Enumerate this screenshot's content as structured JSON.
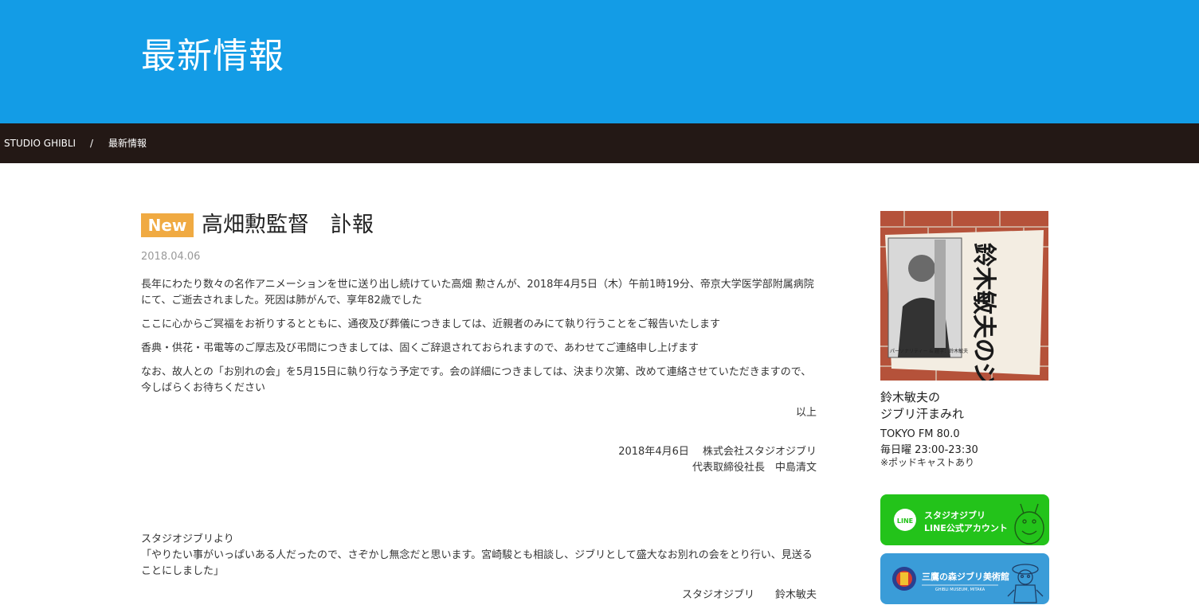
{
  "header": {
    "title": "最新情報"
  },
  "breadcrumb": {
    "home": "STUDIO GHIBLI",
    "separator": "/",
    "current": "最新情報"
  },
  "article": {
    "badge": "New",
    "title": "高畑勲監督　訃報",
    "date": "2018.04.06",
    "paragraphs": [
      "長年にわたり数々の名作アニメーションを世に送り出し続けていた高畑 勲さんが、2018年4月5日（木）午前1時19分、帝京大学医学部附属病院にて、ご逝去されました。死因は肺がんで、享年82歳でした",
      "ここに心からご冥福をお祈りするとともに、通夜及び葬儀につきましては、近親者のみにて執り行うことをご報告いたします",
      "香典・供花・弔電等のご厚志及び弔問につきましては、固くご辞退されておられますので、あわせてご連絡申し上げます",
      "なお、故人との「お別れの会」を5月15日に執り行なう予定です。会の詳細につきましては、決まり次第、改めて連絡させていただきますので、今しばらくお待ちください"
    ],
    "closing": "以上",
    "sign_line1": "2018年4月6日　 株式会社スタジオジブリ",
    "sign_line2": "代表取締役社長　中島清文",
    "from_label": "スタジオジブリより",
    "quote": "「やりたい事がいっぱいある人だったので、さぞかし無念だと思います。宮崎駿とも相談し、ジブリとして盛大なお別れの会をとり行い、見送ることにしました」",
    "quote_sign": "スタジオジブリ　　鈴木敏夫"
  },
  "sidebar": {
    "radio_image_title": "鈴木敏夫のジブリ汗まみれ",
    "radio_image_caption": "パーソナリティー & 題字：鈴木敏夫",
    "radio_name_line1": "鈴木敏夫の",
    "radio_name_line2": "ジブリ汗まみれ",
    "radio_station": "TOKYO FM 80.0",
    "radio_time": "毎日曜 23:00-23:30",
    "radio_note": "※ポッドキャストあり",
    "line_banner": {
      "badge": "LINE",
      "line1": "スタジオジブリ",
      "line2": "LINE公式アカウント"
    },
    "museum_banner": {
      "title": "三鷹の森ジブリ美術館",
      "subtitle": "GHIBLI MUSEUM, MITAKA"
    }
  },
  "colors": {
    "header_bg": "#139ce6",
    "breadcrumb_bg": "#231815",
    "badge": "#f0aa42",
    "line_green": "#23c31a",
    "museum_blue": "#3a9cd8"
  }
}
